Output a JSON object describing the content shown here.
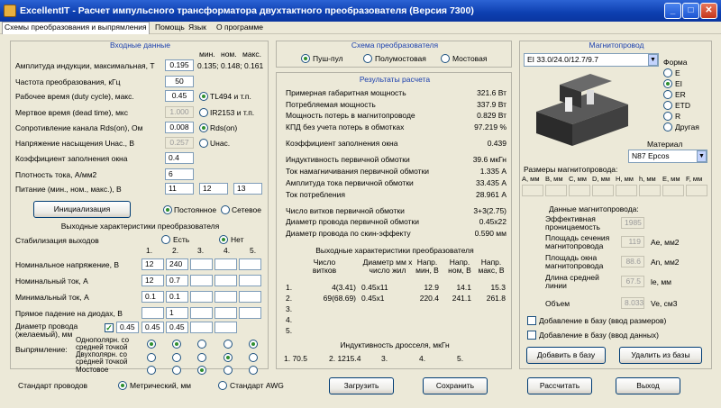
{
  "window": {
    "title": "ExcellentIT - Расчет импульсного трансформатора двухтактного преобразователя (Версия 7300)",
    "min": "_",
    "max": "□",
    "close": "✕"
  },
  "menu": [
    "Схемы преобразования и выпрямления",
    "Помощь",
    "Язык",
    "О программе"
  ],
  "input": {
    "title": "Входные данные",
    "col_headers": [
      "мин.",
      "ном.",
      "макс."
    ],
    "rows": [
      {
        "label": "Амплитуда индукции, максимальная, Т",
        "value": "0.195",
        "extra": "0.135; 0.148; 0.161"
      },
      {
        "label": "Частота преобразования, кГц",
        "value": "50"
      },
      {
        "label": "Рабочее время (duty cycle), макс.",
        "value": "0.45",
        "opt": "TL494 и т.п."
      },
      {
        "label": "Мертвое время (dead time), мкс",
        "value": "1.000",
        "opt": "IR2153 и т.п."
      },
      {
        "label": "Сопротивление канала Rds(on), Ом",
        "value": "0.008",
        "opt": "Rds(on)"
      },
      {
        "label": "Напряжение насыщения Uнас., В",
        "value": "0.257",
        "opt": "Uнас."
      },
      {
        "label": "Коэффициент заполнения окна",
        "value": "0.4"
      },
      {
        "label": "Плотность тока, А/мм2",
        "value": "6"
      },
      {
        "label": "Питание (мин., ном., макс.), В",
        "values": [
          "11",
          "12",
          "13"
        ]
      }
    ],
    "init_button": "Инициализация",
    "supply_types": [
      "Постоянное",
      "Сетевое"
    ]
  },
  "output": {
    "title": "Выходные характеристики преобразователя",
    "stab_label": "Стабилизация выходов",
    "stab_opts": [
      "Есть",
      "Нет"
    ],
    "col_nums": [
      "1.",
      "2.",
      "3.",
      "4.",
      "5."
    ],
    "rows": [
      {
        "label": "Номинальное напряжение, В",
        "values": [
          "12",
          "240",
          "",
          "",
          ""
        ]
      },
      {
        "label": "Номинальный ток, А",
        "values": [
          "12",
          "0.7",
          "",
          "",
          ""
        ]
      },
      {
        "label": "Минимальный ток, А",
        "values": [
          "0.1",
          "0.1",
          "",
          "",
          ""
        ]
      },
      {
        "label": "Прямое падение на диодах, В",
        "values": [
          "",
          "1",
          "",
          "",
          ""
        ]
      },
      {
        "label": "Диаметр провода (желаемый), мм",
        "values": [
          "0.45",
          "0.45",
          "0.45",
          "",
          ""
        ]
      }
    ],
    "rect_label": "Выпрямление:",
    "rect_types": [
      "Однополярн. со средней точкой",
      "Двухполярн. со средней точкой",
      "Мостовое"
    ],
    "wire_std_label": "Стандарт проводов",
    "wire_std_opts": [
      "Метрический, мм",
      "Стандарт AWG"
    ]
  },
  "scheme": {
    "title": "Схема преобразователя",
    "opts": [
      "Пуш-пул",
      "Полумостовая",
      "Мостовая"
    ]
  },
  "results": {
    "title": "Результаты расчета",
    "lines": [
      [
        "Примерная габаритная мощность",
        "321.6 Вт"
      ],
      [
        "Потребляемая мощность",
        "337.9 Вт"
      ],
      [
        "Мощность потерь в магнитопроводе",
        "0.829 Вт"
      ],
      [
        "КПД без учета потерь в обмотках",
        "97.219 %"
      ],
      [
        "Коэффициент заполнения окна",
        "0.439"
      ],
      [
        "Индуктивность первичной обмотки",
        "39.6 мкГн"
      ],
      [
        "Ток намагничивания первичной обмотки",
        "1.335 А"
      ],
      [
        "Амплитуда тока первичной обмотки",
        "33.435 А"
      ],
      [
        "Ток потребления",
        "28.961 А"
      ],
      [
        "Число витков первичной обмотки",
        "3+3(2.75)"
      ],
      [
        "Диаметр провода первичной обмотки",
        "0.45x22"
      ],
      [
        "Диаметр провода по скин-эффекту",
        "0.590 мм"
      ]
    ],
    "out_title": "Выходные характеристики преобразователя",
    "out_headers": [
      "Число витков",
      "Диаметр мм x число жил",
      "Напр. мин, В",
      "Напр. ном, В",
      "Напр. макс, В"
    ],
    "out_rows": [
      [
        "1.",
        "4(3.41)",
        "0.45x11",
        "12.9",
        "14.1",
        "15.3"
      ],
      [
        "2.",
        "69(68.69)",
        "0.45x1",
        "220.4",
        "241.1",
        "261.8"
      ],
      [
        "3.",
        "",
        "",
        "",
        "",
        ""
      ],
      [
        "4.",
        "",
        "",
        "",
        "",
        ""
      ],
      [
        "5.",
        "",
        "",
        "",
        "",
        ""
      ]
    ],
    "choke_title": "Индуктивность дросселя, мкГн",
    "choke_values": [
      "1. 70.5",
      "2. 1215.4",
      "3.",
      "4.",
      "5."
    ]
  },
  "core": {
    "title": "Магнитопровод",
    "selected": "EI 33.0/24.0/12.7/9.7",
    "shape_label": "Форма",
    "shapes": [
      "E",
      "EI",
      "ER",
      "ETD",
      "R",
      "Другая"
    ],
    "material_label": "Материал",
    "material": "N87 Epcos",
    "dims_title": "Размеры магнитопровода:",
    "dims_cols": [
      "A, мм",
      "B, мм",
      "C, мм",
      "D, мм",
      "H, мм",
      "h, мм",
      "E, мм",
      "F, мм"
    ],
    "data_title": "Данные магнитопровода:",
    "params": [
      {
        "label": "Эффективная проницаемость",
        "value": "1985",
        "unit": ""
      },
      {
        "label": "Площадь сечения магнитопровода",
        "value": "119",
        "unit": "Ae, мм2"
      },
      {
        "label": "Площадь окна магнитопровода",
        "value": "88.6",
        "unit": "An, мм2"
      },
      {
        "label": "Длина средней линии",
        "value": "67.5",
        "unit": "le, мм"
      },
      {
        "label": "Объем",
        "value": "8.033",
        "unit": "Ve, см3"
      }
    ],
    "add_dims": "Добавление в базу (ввод размеров)",
    "add_data": "Добавление в базу (ввод данных)",
    "add_btn": "Добавить в базу",
    "del_btn": "Удалить из базы"
  },
  "buttons": {
    "load": "Загрузить",
    "save": "Сохранить",
    "calc": "Рассчитать",
    "exit": "Выход"
  },
  "colors": {
    "titlebar": "#0d3fb0",
    "section_title": "#1a3fae",
    "background": "#ece9d8"
  }
}
